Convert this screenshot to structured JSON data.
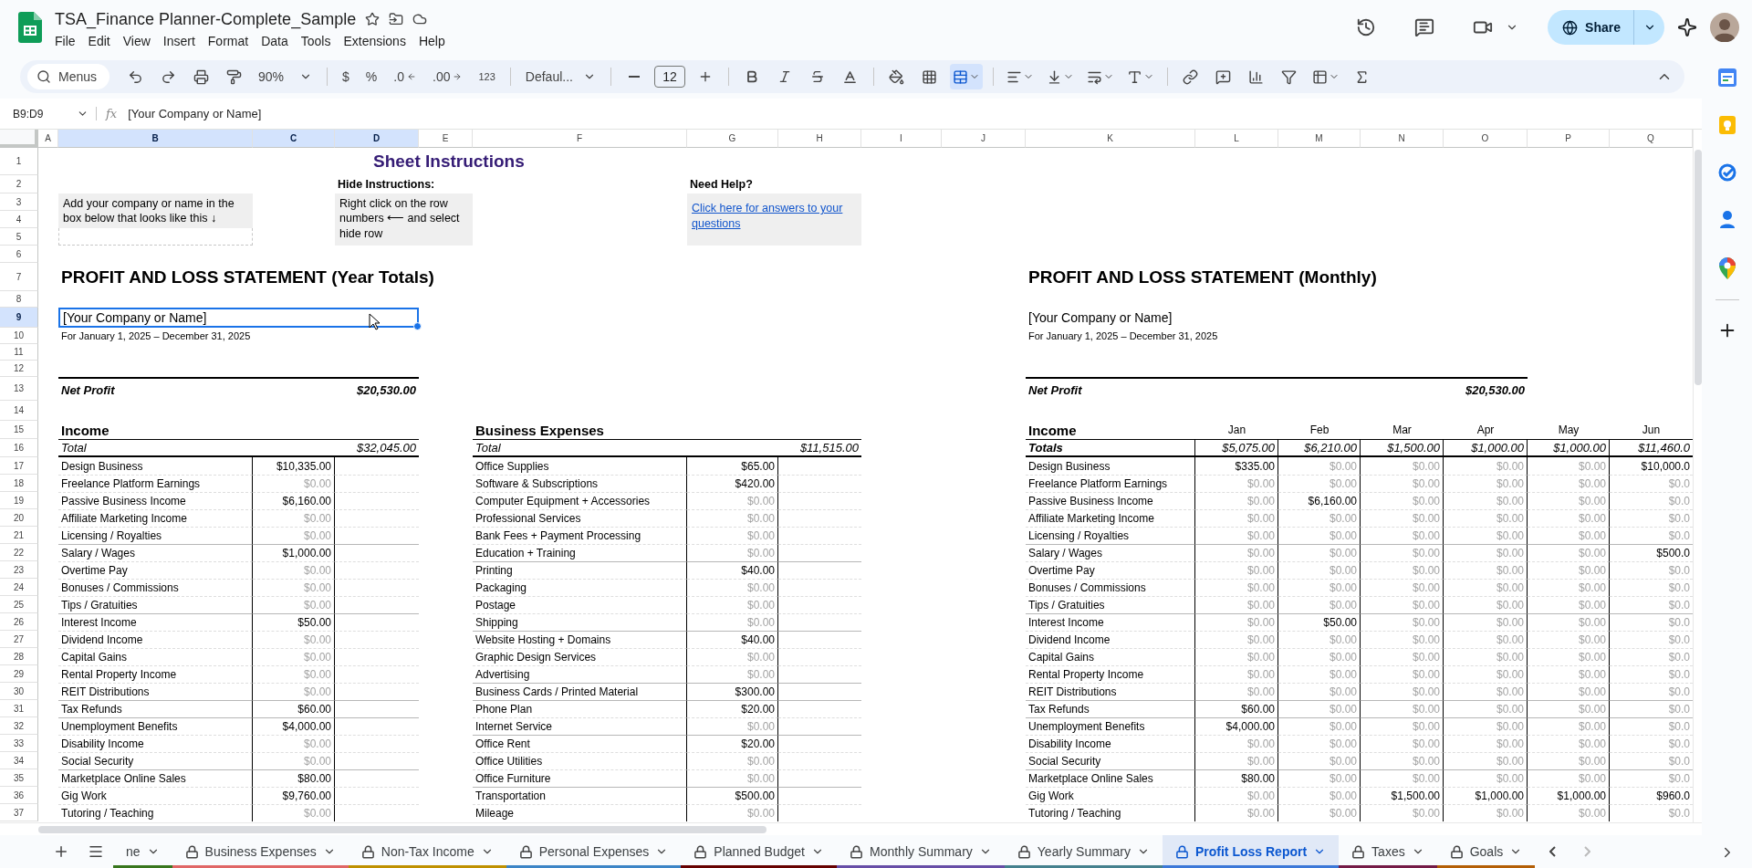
{
  "document": {
    "title": "TSA_Finance Planner-Complete_Sample",
    "menu": [
      "File",
      "Edit",
      "View",
      "Insert",
      "Format",
      "Data",
      "Tools",
      "Extensions",
      "Help"
    ]
  },
  "header_actions": {
    "share": "Share"
  },
  "toolbar": {
    "search": "Menus",
    "zoom": "90%",
    "number_formats": [
      {
        "label": "$",
        "kind": "currency"
      },
      {
        "label": "%",
        "kind": "percent"
      },
      {
        "label": ".0",
        "kind": "decrease-decimal"
      },
      {
        "label": ".00",
        "kind": "increase-decimal"
      },
      {
        "label": "123",
        "kind": "more-formats"
      }
    ],
    "font": "Defaul...",
    "font_size": "12",
    "merge_selected": true
  },
  "formula_bar": {
    "cell_ref": "B9:D9",
    "fx_label": "fx",
    "formula": "[Your Company or Name]"
  },
  "columns": [
    {
      "label": "A",
      "selected": false
    },
    {
      "label": "B",
      "selected": true
    },
    {
      "label": "C",
      "selected": true
    },
    {
      "label": "D",
      "selected": true
    },
    {
      "label": "E",
      "selected": false
    },
    {
      "label": "F",
      "selected": false
    },
    {
      "label": "G",
      "selected": false
    },
    {
      "label": "H",
      "selected": false
    },
    {
      "label": "I",
      "selected": false
    },
    {
      "label": "J",
      "selected": false
    },
    {
      "label": "K",
      "selected": false
    },
    {
      "label": "L",
      "selected": false
    },
    {
      "label": "M",
      "selected": false
    },
    {
      "label": "N",
      "selected": false
    },
    {
      "label": "O",
      "selected": false
    },
    {
      "label": "P",
      "selected": false
    },
    {
      "label": "Q",
      "selected": false
    }
  ],
  "row_headers": [
    {
      "label": "1",
      "selected": false
    },
    {
      "label": "2",
      "selected": false
    },
    {
      "label": "3",
      "selected": false
    },
    {
      "label": "4",
      "selected": false
    },
    {
      "label": "5",
      "selected": false
    },
    {
      "label": "6",
      "selected": false
    },
    {
      "label": "7",
      "selected": false
    },
    {
      "label": "8",
      "selected": false
    },
    {
      "label": "9",
      "selected": true
    },
    {
      "label": "10",
      "selected": false
    },
    {
      "label": "11",
      "selected": false
    },
    {
      "label": "12",
      "selected": false
    },
    {
      "label": "13",
      "selected": false
    },
    {
      "label": "14",
      "selected": false
    },
    {
      "label": "15",
      "selected": false
    },
    {
      "label": "16",
      "selected": false
    },
    {
      "label": "17",
      "selected": false
    },
    {
      "label": "18",
      "selected": false
    },
    {
      "label": "19",
      "selected": false
    },
    {
      "label": "20",
      "selected": false
    },
    {
      "label": "21",
      "selected": false
    },
    {
      "label": "22",
      "selected": false
    },
    {
      "label": "23",
      "selected": false
    },
    {
      "label": "24",
      "selected": false
    },
    {
      "label": "25",
      "selected": false
    },
    {
      "label": "26",
      "selected": false
    },
    {
      "label": "27",
      "selected": false
    },
    {
      "label": "28",
      "selected": false
    },
    {
      "label": "29",
      "selected": false
    },
    {
      "label": "30",
      "selected": false
    },
    {
      "label": "31",
      "selected": false
    },
    {
      "label": "32",
      "selected": false
    },
    {
      "label": "33",
      "selected": false
    },
    {
      "label": "34",
      "selected": false
    },
    {
      "label": "35",
      "selected": false
    },
    {
      "label": "36",
      "selected": false
    },
    {
      "label": "37",
      "selected": false
    }
  ],
  "instructions": {
    "title": "Sheet Instructions",
    "company_note": "Add your company or name in the box below that looks like this  ↓",
    "hide_label": "Hide Instructions:",
    "hide_text": "Right click on the row numbers ⟵  and select hide row",
    "help_label": "Need Help?",
    "help_link": "Click here for answers to your questions"
  },
  "year_report": {
    "title": "PROFIT AND LOSS STATEMENT (Year Totals)",
    "company": {
      "text": "[Your Company or Name]",
      "selected": true
    },
    "period": "For January 1, 2025 – December 31, 2025",
    "net_profit": {
      "label": "Net Profit",
      "value": "$20,530.00"
    },
    "income": {
      "heading": "Income",
      "total_label": "Total",
      "total": "$32,045.00",
      "rows": [
        {
          "label": "Design Business",
          "value": "$10,335.00",
          "dimmed": false,
          "group_start": false
        },
        {
          "label": "Freelance Platform Earnings",
          "value": "$0.00",
          "dimmed": true,
          "group_start": false
        },
        {
          "label": "Passive Business Income",
          "value": "$6,160.00",
          "dimmed": false,
          "group_start": false
        },
        {
          "label": "Affiliate Marketing Income",
          "value": "$0.00",
          "dimmed": true,
          "group_start": false
        },
        {
          "label": "Licensing / Royalties",
          "value": "$0.00",
          "dimmed": true,
          "group_start": false
        },
        {
          "label": "Salary / Wages",
          "value": "$1,000.00",
          "dimmed": false,
          "group_start": true
        },
        {
          "label": "Overtime Pay",
          "value": "$0.00",
          "dimmed": true,
          "group_start": false
        },
        {
          "label": "Bonuses / Commissions",
          "value": "$0.00",
          "dimmed": true,
          "group_start": false
        },
        {
          "label": "Tips / Gratuities",
          "value": "$0.00",
          "dimmed": true,
          "group_start": false
        },
        {
          "label": "Interest Income",
          "value": "$50.00",
          "dimmed": false,
          "group_start": true
        },
        {
          "label": "Dividend Income",
          "value": "$0.00",
          "dimmed": true,
          "group_start": false
        },
        {
          "label": "Capital Gains",
          "value": "$0.00",
          "dimmed": true,
          "group_start": false
        },
        {
          "label": "Rental Property Income",
          "value": "$0.00",
          "dimmed": true,
          "group_start": false
        },
        {
          "label": "REIT Distributions",
          "value": "$0.00",
          "dimmed": true,
          "group_start": false
        },
        {
          "label": "Tax Refunds",
          "value": "$60.00",
          "dimmed": false,
          "group_start": true
        },
        {
          "label": "Unemployment Benefits",
          "value": "$4,000.00",
          "dimmed": false,
          "group_start": true
        },
        {
          "label": "Disability Income",
          "value": "$0.00",
          "dimmed": true,
          "group_start": false
        },
        {
          "label": "Social Security",
          "value": "$0.00",
          "dimmed": true,
          "group_start": false
        },
        {
          "label": "Marketplace Online Sales",
          "value": "$80.00",
          "dimmed": false,
          "group_start": true
        },
        {
          "label": "Gig Work",
          "value": "$9,760.00",
          "dimmed": false,
          "group_start": false
        },
        {
          "label": "Tutoring / Teaching",
          "value": "$0.00",
          "dimmed": true,
          "group_start": false
        }
      ]
    },
    "expenses": {
      "heading": "Business Expenses",
      "total_label": "Total",
      "total": "$11,515.00",
      "rows": [
        {
          "label": "Office Supplies",
          "value": "$65.00",
          "dimmed": false,
          "group_start": false
        },
        {
          "label": "Software & Subscriptions",
          "value": "$420.00",
          "dimmed": false,
          "group_start": false
        },
        {
          "label": "Computer Equipment + Accessories",
          "value": "$0.00",
          "dimmed": true,
          "group_start": false
        },
        {
          "label": "Professional Services",
          "value": "$0.00",
          "dimmed": true,
          "group_start": false
        },
        {
          "label": "Bank Fees + Payment Processing",
          "value": "$0.00",
          "dimmed": true,
          "group_start": false
        },
        {
          "label": "Education + Training",
          "value": "$0.00",
          "dimmed": true,
          "group_start": false
        },
        {
          "label": "Printing",
          "value": "$40.00",
          "dimmed": false,
          "group_start": true
        },
        {
          "label": "Packaging",
          "value": "$0.00",
          "dimmed": true,
          "group_start": false
        },
        {
          "label": "Postage",
          "value": "$0.00",
          "dimmed": true,
          "group_start": false
        },
        {
          "label": "Shipping",
          "value": "$0.00",
          "dimmed": true,
          "group_start": false
        },
        {
          "label": "Website Hosting + Domains",
          "value": "$40.00",
          "dimmed": false,
          "group_start": true
        },
        {
          "label": "Graphic Design Services",
          "value": "$0.00",
          "dimmed": true,
          "group_start": false
        },
        {
          "label": "Advertising",
          "value": "$0.00",
          "dimmed": true,
          "group_start": false
        },
        {
          "label": "Business Cards / Printed Material",
          "value": "$300.00",
          "dimmed": false,
          "group_start": true
        },
        {
          "label": "Phone Plan",
          "value": "$20.00",
          "dimmed": false,
          "group_start": true
        },
        {
          "label": "Internet Service",
          "value": "$0.00",
          "dimmed": true,
          "group_start": false
        },
        {
          "label": "Office Rent",
          "value": "$20.00",
          "dimmed": false,
          "group_start": true
        },
        {
          "label": "Office Utilities",
          "value": "$0.00",
          "dimmed": true,
          "group_start": false
        },
        {
          "label": "Office Furniture",
          "value": "$0.00",
          "dimmed": true,
          "group_start": false
        },
        {
          "label": "Transportation",
          "value": "$500.00",
          "dimmed": false,
          "group_start": true
        },
        {
          "label": "Mileage",
          "value": "$0.00",
          "dimmed": true,
          "group_start": false
        }
      ]
    }
  },
  "monthly_report": {
    "title": "PROFIT AND LOSS STATEMENT (Monthly)",
    "company": "[Your Company or Name]",
    "period": "For January 1, 2025 – December 31, 2025",
    "net_profit": {
      "label": "Net Profit",
      "value": "$20,530.00"
    },
    "heading": "Income",
    "months": [
      "Jan",
      "Feb",
      "Mar",
      "Apr",
      "May",
      "Jun"
    ],
    "total_label": "Totals",
    "totals": [
      "$5,075.00",
      "$6,210.00",
      "$1,500.00",
      "$1,000.00",
      "$1,000.00",
      "$11,460.0"
    ],
    "rows": [
      {
        "label": "Design Business",
        "group_start": false,
        "cells": [
          {
            "value": "$335.00",
            "dimmed": false
          },
          {
            "value": "$0.00",
            "dimmed": true
          },
          {
            "value": "$0.00",
            "dimmed": true
          },
          {
            "value": "$0.00",
            "dimmed": true
          },
          {
            "value": "$0.00",
            "dimmed": true
          },
          {
            "value": "$10,000.0",
            "dimmed": false
          }
        ]
      },
      {
        "label": "Freelance Platform Earnings",
        "group_start": false,
        "cells": [
          {
            "value": "$0.00",
            "dimmed": true
          },
          {
            "value": "$0.00",
            "dimmed": true
          },
          {
            "value": "$0.00",
            "dimmed": true
          },
          {
            "value": "$0.00",
            "dimmed": true
          },
          {
            "value": "$0.00",
            "dimmed": true
          },
          {
            "value": "$0.0",
            "dimmed": true
          }
        ]
      },
      {
        "label": "Passive Business Income",
        "group_start": false,
        "cells": [
          {
            "value": "$0.00",
            "dimmed": true
          },
          {
            "value": "$6,160.00",
            "dimmed": false
          },
          {
            "value": "$0.00",
            "dimmed": true
          },
          {
            "value": "$0.00",
            "dimmed": true
          },
          {
            "value": "$0.00",
            "dimmed": true
          },
          {
            "value": "$0.0",
            "dimmed": true
          }
        ]
      },
      {
        "label": "Affiliate Marketing Income",
        "group_start": false,
        "cells": [
          {
            "value": "$0.00",
            "dimmed": true
          },
          {
            "value": "$0.00",
            "dimmed": true
          },
          {
            "value": "$0.00",
            "dimmed": true
          },
          {
            "value": "$0.00",
            "dimmed": true
          },
          {
            "value": "$0.00",
            "dimmed": true
          },
          {
            "value": "$0.0",
            "dimmed": true
          }
        ]
      },
      {
        "label": "Licensing / Royalties",
        "group_start": false,
        "cells": [
          {
            "value": "$0.00",
            "dimmed": true
          },
          {
            "value": "$0.00",
            "dimmed": true
          },
          {
            "value": "$0.00",
            "dimmed": true
          },
          {
            "value": "$0.00",
            "dimmed": true
          },
          {
            "value": "$0.00",
            "dimmed": true
          },
          {
            "value": "$0.0",
            "dimmed": true
          }
        ]
      },
      {
        "label": "Salary / Wages",
        "group_start": true,
        "cells": [
          {
            "value": "$0.00",
            "dimmed": true
          },
          {
            "value": "$0.00",
            "dimmed": true
          },
          {
            "value": "$0.00",
            "dimmed": true
          },
          {
            "value": "$0.00",
            "dimmed": true
          },
          {
            "value": "$0.00",
            "dimmed": true
          },
          {
            "value": "$500.0",
            "dimmed": false
          }
        ]
      },
      {
        "label": "Overtime Pay",
        "group_start": false,
        "cells": [
          {
            "value": "$0.00",
            "dimmed": true
          },
          {
            "value": "$0.00",
            "dimmed": true
          },
          {
            "value": "$0.00",
            "dimmed": true
          },
          {
            "value": "$0.00",
            "dimmed": true
          },
          {
            "value": "$0.00",
            "dimmed": true
          },
          {
            "value": "$0.0",
            "dimmed": true
          }
        ]
      },
      {
        "label": "Bonuses / Commissions",
        "group_start": false,
        "cells": [
          {
            "value": "$0.00",
            "dimmed": true
          },
          {
            "value": "$0.00",
            "dimmed": true
          },
          {
            "value": "$0.00",
            "dimmed": true
          },
          {
            "value": "$0.00",
            "dimmed": true
          },
          {
            "value": "$0.00",
            "dimmed": true
          },
          {
            "value": "$0.0",
            "dimmed": true
          }
        ]
      },
      {
        "label": "Tips / Gratuities",
        "group_start": false,
        "cells": [
          {
            "value": "$0.00",
            "dimmed": true
          },
          {
            "value": "$0.00",
            "dimmed": true
          },
          {
            "value": "$0.00",
            "dimmed": true
          },
          {
            "value": "$0.00",
            "dimmed": true
          },
          {
            "value": "$0.00",
            "dimmed": true
          },
          {
            "value": "$0.0",
            "dimmed": true
          }
        ]
      },
      {
        "label": "Interest Income",
        "group_start": true,
        "cells": [
          {
            "value": "$0.00",
            "dimmed": true
          },
          {
            "value": "$50.00",
            "dimmed": false
          },
          {
            "value": "$0.00",
            "dimmed": true
          },
          {
            "value": "$0.00",
            "dimmed": true
          },
          {
            "value": "$0.00",
            "dimmed": true
          },
          {
            "value": "$0.0",
            "dimmed": true
          }
        ]
      },
      {
        "label": "Dividend Income",
        "group_start": false,
        "cells": [
          {
            "value": "$0.00",
            "dimmed": true
          },
          {
            "value": "$0.00",
            "dimmed": true
          },
          {
            "value": "$0.00",
            "dimmed": true
          },
          {
            "value": "$0.00",
            "dimmed": true
          },
          {
            "value": "$0.00",
            "dimmed": true
          },
          {
            "value": "$0.0",
            "dimmed": true
          }
        ]
      },
      {
        "label": "Capital Gains",
        "group_start": false,
        "cells": [
          {
            "value": "$0.00",
            "dimmed": true
          },
          {
            "value": "$0.00",
            "dimmed": true
          },
          {
            "value": "$0.00",
            "dimmed": true
          },
          {
            "value": "$0.00",
            "dimmed": true
          },
          {
            "value": "$0.00",
            "dimmed": true
          },
          {
            "value": "$0.0",
            "dimmed": true
          }
        ]
      },
      {
        "label": "Rental Property Income",
        "group_start": false,
        "cells": [
          {
            "value": "$0.00",
            "dimmed": true
          },
          {
            "value": "$0.00",
            "dimmed": true
          },
          {
            "value": "$0.00",
            "dimmed": true
          },
          {
            "value": "$0.00",
            "dimmed": true
          },
          {
            "value": "$0.00",
            "dimmed": true
          },
          {
            "value": "$0.0",
            "dimmed": true
          }
        ]
      },
      {
        "label": "REIT Distributions",
        "group_start": false,
        "cells": [
          {
            "value": "$0.00",
            "dimmed": true
          },
          {
            "value": "$0.00",
            "dimmed": true
          },
          {
            "value": "$0.00",
            "dimmed": true
          },
          {
            "value": "$0.00",
            "dimmed": true
          },
          {
            "value": "$0.00",
            "dimmed": true
          },
          {
            "value": "$0.0",
            "dimmed": true
          }
        ]
      },
      {
        "label": "Tax Refunds",
        "group_start": true,
        "cells": [
          {
            "value": "$60.00",
            "dimmed": false
          },
          {
            "value": "$0.00",
            "dimmed": true
          },
          {
            "value": "$0.00",
            "dimmed": true
          },
          {
            "value": "$0.00",
            "dimmed": true
          },
          {
            "value": "$0.00",
            "dimmed": true
          },
          {
            "value": "$0.0",
            "dimmed": true
          }
        ]
      },
      {
        "label": "Unemployment Benefits",
        "group_start": true,
        "cells": [
          {
            "value": "$4,000.00",
            "dimmed": false
          },
          {
            "value": "$0.00",
            "dimmed": true
          },
          {
            "value": "$0.00",
            "dimmed": true
          },
          {
            "value": "$0.00",
            "dimmed": true
          },
          {
            "value": "$0.00",
            "dimmed": true
          },
          {
            "value": "$0.0",
            "dimmed": true
          }
        ]
      },
      {
        "label": "Disability Income",
        "group_start": false,
        "cells": [
          {
            "value": "$0.00",
            "dimmed": true
          },
          {
            "value": "$0.00",
            "dimmed": true
          },
          {
            "value": "$0.00",
            "dimmed": true
          },
          {
            "value": "$0.00",
            "dimmed": true
          },
          {
            "value": "$0.00",
            "dimmed": true
          },
          {
            "value": "$0.0",
            "dimmed": true
          }
        ]
      },
      {
        "label": "Social Security",
        "group_start": false,
        "cells": [
          {
            "value": "$0.00",
            "dimmed": true
          },
          {
            "value": "$0.00",
            "dimmed": true
          },
          {
            "value": "$0.00",
            "dimmed": true
          },
          {
            "value": "$0.00",
            "dimmed": true
          },
          {
            "value": "$0.00",
            "dimmed": true
          },
          {
            "value": "$0.0",
            "dimmed": true
          }
        ]
      },
      {
        "label": "Marketplace Online Sales",
        "group_start": true,
        "cells": [
          {
            "value": "$80.00",
            "dimmed": false
          },
          {
            "value": "$0.00",
            "dimmed": true
          },
          {
            "value": "$0.00",
            "dimmed": true
          },
          {
            "value": "$0.00",
            "dimmed": true
          },
          {
            "value": "$0.00",
            "dimmed": true
          },
          {
            "value": "$0.0",
            "dimmed": true
          }
        ]
      },
      {
        "label": "Gig Work",
        "group_start": false,
        "cells": [
          {
            "value": "$0.00",
            "dimmed": true
          },
          {
            "value": "$0.00",
            "dimmed": true
          },
          {
            "value": "$1,500.00",
            "dimmed": false
          },
          {
            "value": "$1,000.00",
            "dimmed": false
          },
          {
            "value": "$1,000.00",
            "dimmed": false
          },
          {
            "value": "$960.0",
            "dimmed": false
          }
        ]
      },
      {
        "label": "Tutoring / Teaching",
        "group_start": false,
        "cells": [
          {
            "value": "$0.00",
            "dimmed": true
          },
          {
            "value": "$0.00",
            "dimmed": true
          },
          {
            "value": "$0.00",
            "dimmed": true
          },
          {
            "value": "$0.00",
            "dimmed": true
          },
          {
            "value": "$0.00",
            "dimmed": true
          },
          {
            "value": "$0.0",
            "dimmed": true
          }
        ]
      }
    ]
  },
  "sheet_tabs": [
    {
      "label": "ne",
      "locked": false,
      "selected": false,
      "color": "#38761d"
    },
    {
      "label": "Business Expenses",
      "locked": true,
      "selected": false,
      "color": "#e06666"
    },
    {
      "label": "Non-Tax Income",
      "locked": true,
      "selected": false,
      "color": "#bf9000"
    },
    {
      "label": "Personal Expenses",
      "locked": true,
      "selected": false,
      "color": "#3d85c6"
    },
    {
      "label": "Planned Budget",
      "locked": true,
      "selected": false,
      "color": "#660000"
    },
    {
      "label": "Monthly Summary",
      "locked": true,
      "selected": false,
      "color": "#674ea7"
    },
    {
      "label": "Yearly Summary",
      "locked": true,
      "selected": false,
      "color": "#45818e"
    },
    {
      "label": "Profit Loss Report",
      "locked": true,
      "selected": true,
      "color": "#3c78d8"
    },
    {
      "label": "Taxes",
      "locked": true,
      "selected": false,
      "color": "#741b47"
    },
    {
      "label": "Goals",
      "locked": true,
      "selected": false,
      "color": "#b45f06"
    }
  ]
}
